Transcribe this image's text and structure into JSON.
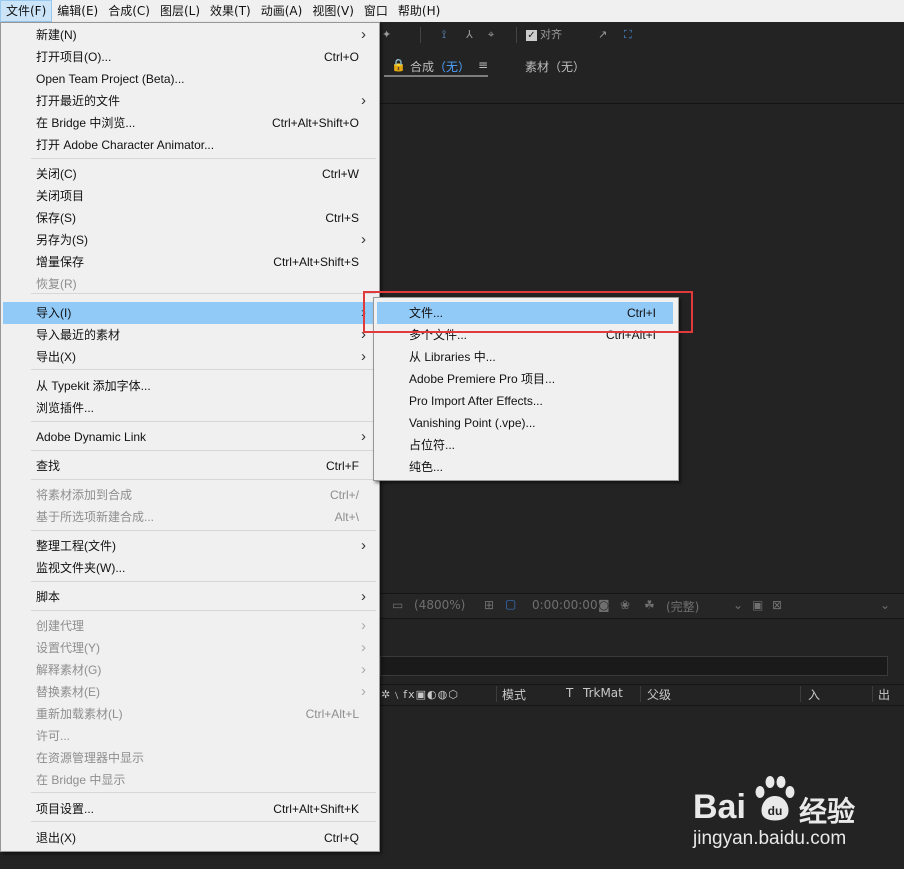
{
  "menubar": {
    "items": [
      "文件(F)",
      "编辑(E)",
      "合成(C)",
      "图层(L)",
      "效果(T)",
      "动画(A)",
      "视图(V)",
      "窗口",
      "帮助(H)"
    ]
  },
  "toolbar": {
    "snap_label": "对齐"
  },
  "tabs": {
    "comp_label": "合成",
    "comp_value": "（无）",
    "footage_label": "素材",
    "footage_value": "（无）"
  },
  "timeline": {
    "zoom": "(4800%)",
    "timecode": "0:00:00:00",
    "quality": "(完整)",
    "col_mode": "模式",
    "col_t": "T",
    "col_trkmat": "TrkMat",
    "col_parent": "父级",
    "col_in": "入",
    "col_out": "出"
  },
  "file_menu": {
    "items": [
      {
        "label": "新建(N)",
        "shortcut": "",
        "submenu": true,
        "disabled": false
      },
      {
        "label": "打开项目(O)...",
        "shortcut": "Ctrl+O",
        "submenu": false,
        "disabled": false
      },
      {
        "label": "Open Team Project (Beta)...",
        "shortcut": "",
        "submenu": false,
        "disabled": false
      },
      {
        "label": "打开最近的文件",
        "shortcut": "",
        "submenu": true,
        "disabled": false
      },
      {
        "label": "在 Bridge 中浏览...",
        "shortcut": "Ctrl+Alt+Shift+O",
        "submenu": false,
        "disabled": false
      },
      {
        "label": "打开 Adobe Character Animator...",
        "shortcut": "",
        "submenu": false,
        "disabled": false
      },
      {
        "label": "关闭(C)",
        "shortcut": "Ctrl+W",
        "submenu": false,
        "disabled": false
      },
      {
        "label": "关闭项目",
        "shortcut": "",
        "submenu": false,
        "disabled": false
      },
      {
        "label": "保存(S)",
        "shortcut": "Ctrl+S",
        "submenu": false,
        "disabled": false
      },
      {
        "label": "另存为(S)",
        "shortcut": "",
        "submenu": true,
        "disabled": false
      },
      {
        "label": "增量保存",
        "shortcut": "Ctrl+Alt+Shift+S",
        "submenu": false,
        "disabled": false
      },
      {
        "label": "恢复(R)",
        "shortcut": "",
        "submenu": false,
        "disabled": true
      },
      {
        "label": "导入(I)",
        "shortcut": "",
        "submenu": true,
        "disabled": false
      },
      {
        "label": "导入最近的素材",
        "shortcut": "",
        "submenu": true,
        "disabled": false
      },
      {
        "label": "导出(X)",
        "shortcut": "",
        "submenu": true,
        "disabled": false
      },
      {
        "label": "从 Typekit 添加字体...",
        "shortcut": "",
        "submenu": false,
        "disabled": false
      },
      {
        "label": "浏览插件...",
        "shortcut": "",
        "submenu": false,
        "disabled": false
      },
      {
        "label": "Adobe Dynamic Link",
        "shortcut": "",
        "submenu": true,
        "disabled": false
      },
      {
        "label": "查找",
        "shortcut": "Ctrl+F",
        "submenu": false,
        "disabled": false
      },
      {
        "label": "将素材添加到合成",
        "shortcut": "Ctrl+/",
        "submenu": false,
        "disabled": true
      },
      {
        "label": "基于所选项新建合成...",
        "shortcut": "Alt+\\",
        "submenu": false,
        "disabled": true
      },
      {
        "label": "整理工程(文件)",
        "shortcut": "",
        "submenu": true,
        "disabled": false
      },
      {
        "label": "监视文件夹(W)...",
        "shortcut": "",
        "submenu": false,
        "disabled": false
      },
      {
        "label": "脚本",
        "shortcut": "",
        "submenu": true,
        "disabled": false
      },
      {
        "label": "创建代理",
        "shortcut": "",
        "submenu": true,
        "disabled": true
      },
      {
        "label": "设置代理(Y)",
        "shortcut": "",
        "submenu": true,
        "disabled": true
      },
      {
        "label": "解释素材(G)",
        "shortcut": "",
        "submenu": true,
        "disabled": true
      },
      {
        "label": "替换素材(E)",
        "shortcut": "",
        "submenu": true,
        "disabled": true
      },
      {
        "label": "重新加载素材(L)",
        "shortcut": "Ctrl+Alt+L",
        "submenu": false,
        "disabled": true
      },
      {
        "label": "许可...",
        "shortcut": "",
        "submenu": false,
        "disabled": true
      },
      {
        "label": "在资源管理器中显示",
        "shortcut": "",
        "submenu": false,
        "disabled": true
      },
      {
        "label": "在 Bridge 中显示",
        "shortcut": "",
        "submenu": false,
        "disabled": true
      },
      {
        "label": "项目设置...",
        "shortcut": "Ctrl+Alt+Shift+K",
        "submenu": false,
        "disabled": false
      },
      {
        "label": "退出(X)",
        "shortcut": "Ctrl+Q",
        "submenu": false,
        "disabled": false
      }
    ],
    "highlighted": "导入(I)"
  },
  "import_menu": {
    "items": [
      {
        "label": "文件...",
        "shortcut": "Ctrl+I"
      },
      {
        "label": "多个文件...",
        "shortcut": "Ctrl+Alt+I"
      },
      {
        "label": "从 Libraries 中...",
        "shortcut": ""
      },
      {
        "label": "Adobe Premiere Pro 项目...",
        "shortcut": ""
      },
      {
        "label": "Pro Import After Effects...",
        "shortcut": ""
      },
      {
        "label": "Vanishing Point (.vpe)...",
        "shortcut": ""
      },
      {
        "label": "占位符...",
        "shortcut": ""
      },
      {
        "label": "纯色...",
        "shortcut": ""
      }
    ],
    "highlighted": "文件..."
  },
  "watermark": {
    "brand": "Bai",
    "brand_cn": "经验",
    "url": "jingyan.baidu.com"
  }
}
